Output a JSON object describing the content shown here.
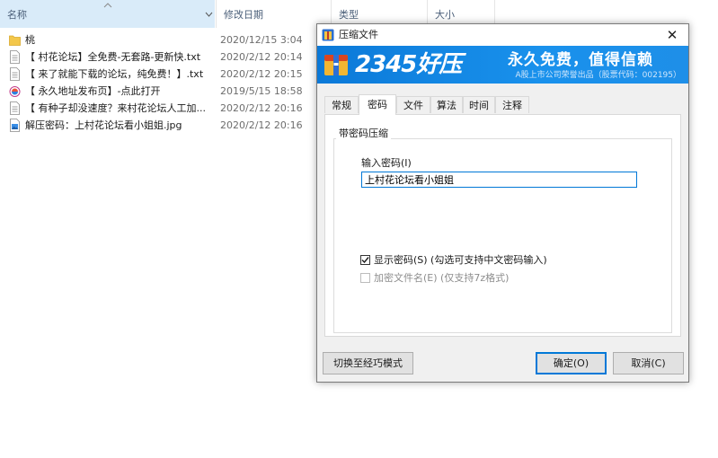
{
  "explorer": {
    "columns": {
      "name": "名称",
      "date": "修改日期",
      "type": "类型",
      "size": "大小"
    },
    "files": [
      {
        "icon": "folder-icon",
        "name": "桃",
        "date": "2020/12/15 3:04"
      },
      {
        "icon": "text-file-icon",
        "name": "【 村花论坛】全免费-无套路-更新快.txt",
        "date": "2020/2/12 20:14"
      },
      {
        "icon": "text-file-icon",
        "name": "【 来了就能下载的论坛，纯免费！】.txt",
        "date": "2020/2/12 20:15"
      },
      {
        "icon": "url-file-icon",
        "name": "【 永久地址发布页】-点此打开",
        "date": "2019/5/15 18:58"
      },
      {
        "icon": "text-file-icon",
        "name": "【 有种子却没速度？来村花论坛人工加...",
        "date": "2020/2/12 20:16"
      },
      {
        "icon": "image-file-icon",
        "name": "解压密码：上村花论坛看小姐姐.jpg",
        "date": "2020/2/12 20:16"
      }
    ]
  },
  "dialog": {
    "title": "压缩文件",
    "close_label": "✕",
    "banner": {
      "brand": "2345好压",
      "slogan": "永久免费，值得信赖",
      "sub": "A股上市公司荣誉出品（股票代码：002195）"
    },
    "tabs": [
      "常规",
      "密码",
      "文件",
      "算法",
      "时间",
      "注释"
    ],
    "active_tab": "密码",
    "group_label": "带密码压缩",
    "password_label": "输入密码(I)",
    "password_value": "上村花论坛看小姐姐",
    "show_password": {
      "label": "显示密码(S)  (勾选可支持中文密码输入)",
      "checked": true
    },
    "encrypt_names": {
      "label": "加密文件名(E)  (仅支持7z格式)",
      "checked": false,
      "disabled": true
    },
    "buttons": {
      "switch_mode": "切换至经巧模式",
      "ok": "确定(O)",
      "cancel": "取消(C)"
    }
  },
  "colors": {
    "banner_blue": "#1588e6",
    "header_selected": "#d9ebf9",
    "accent": "#0078d7"
  }
}
